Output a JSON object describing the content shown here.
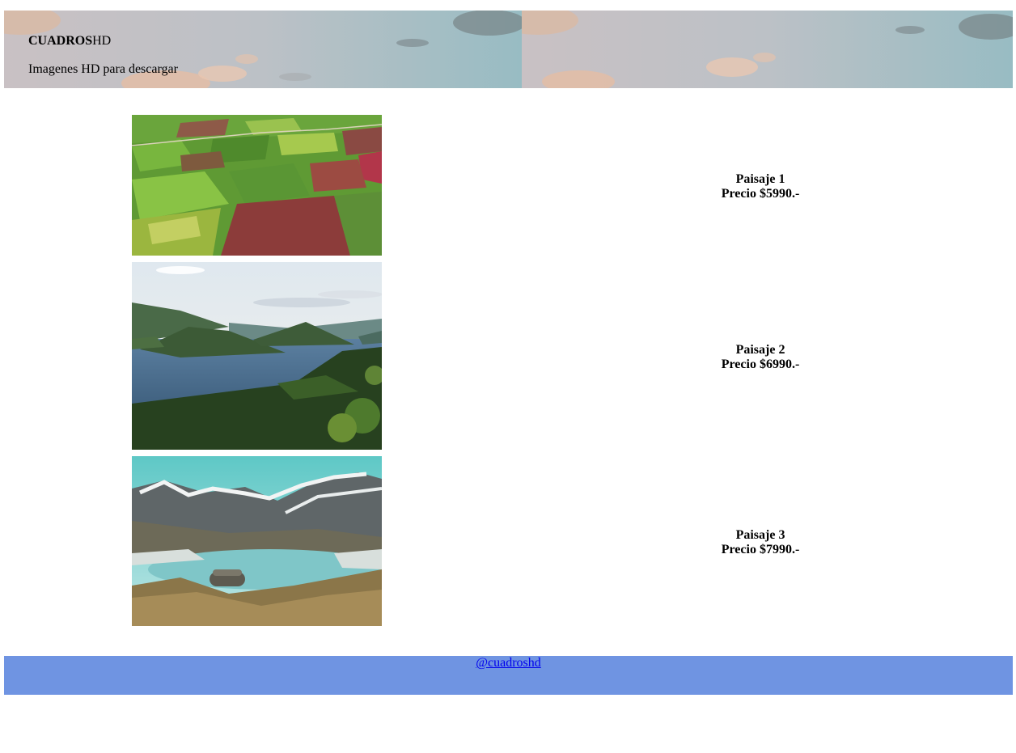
{
  "header": {
    "brand_bold": "CUADROS",
    "brand_rest": "HD",
    "tagline": "Imagenes HD para descargar",
    "banner_image": "sky-with-clouds"
  },
  "products": [
    {
      "name": "Paisaje 1",
      "price": "Precio $5990.-",
      "image": "aerial-farm-fields"
    },
    {
      "name": "Paisaje 2",
      "price": "Precio $6990.-",
      "image": "lake-with-hills"
    },
    {
      "name": "Paisaje 3",
      "price": "Precio $7990.-",
      "image": "mountain-lake"
    }
  ],
  "footer": {
    "link": "@cuadroshd",
    "background": "#6f94e2"
  }
}
